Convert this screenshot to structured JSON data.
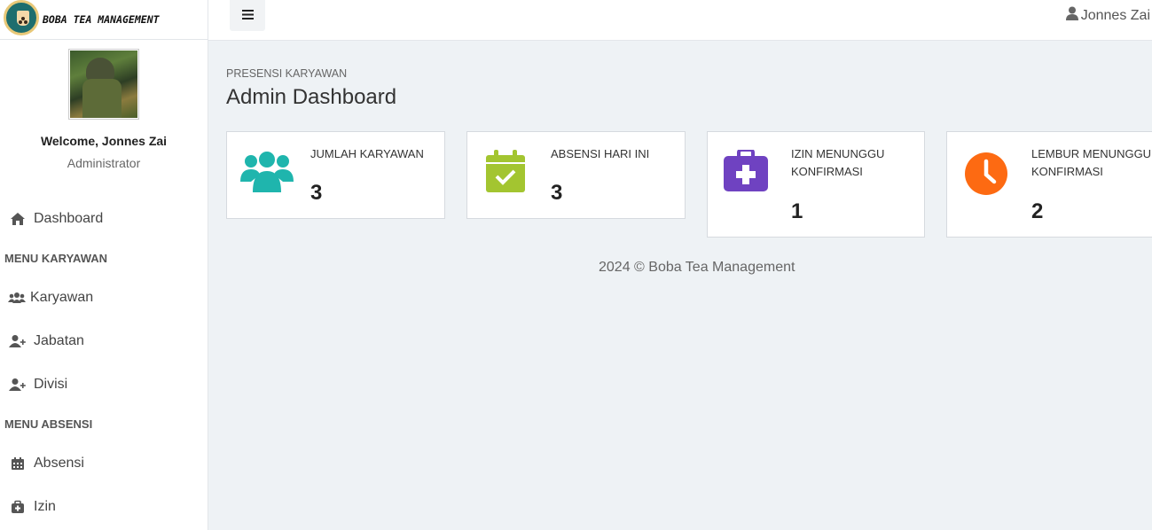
{
  "brand": {
    "name": "BOBA TEA MANAGEMENT",
    "logo_text": "BOBA TEA"
  },
  "profile": {
    "welcome": "Welcome, Jonnes Zai",
    "role": "Administrator"
  },
  "sidebar": {
    "dashboard": "Dashboard",
    "menu_karyawan": "MENU KARYAWAN",
    "karyawan": "Karyawan",
    "jabatan": "Jabatan",
    "divisi": "Divisi",
    "menu_absensi": "MENU ABSENSI",
    "absensi": "Absensi",
    "izin": "Izin"
  },
  "topbar": {
    "menu_icon": "☰",
    "user_name": "Jonnes Zai"
  },
  "page": {
    "breadcrumb": "PRESENSI KARYAWAN",
    "title": "Admin Dashboard"
  },
  "cards": [
    {
      "label": "JUMLAH KARYAWAN",
      "value": "3",
      "icon": "users-icon",
      "color": "#1fb5ad"
    },
    {
      "label": "ABSENSI HARI INI",
      "value": "3",
      "icon": "calendar-check-icon",
      "color": "#a3c530"
    },
    {
      "label": "IZIN MENUNGGU KONFIRMASI",
      "label_line1": "IZIN MENUNGGU",
      "label_line2": "KONFIRMASI",
      "value": "1",
      "icon": "medkit-icon",
      "color": "#6f42c1"
    },
    {
      "label": "LEMBUR MENUNGGU KONFIRMASI",
      "label_line1": "LEMBUR MENUNGGU",
      "label_line2": "KONFIRMASI",
      "value": "2",
      "icon": "clock-icon",
      "color": "#fd6a12"
    }
  ],
  "footer": {
    "text": "2024 © Boba Tea Management"
  }
}
